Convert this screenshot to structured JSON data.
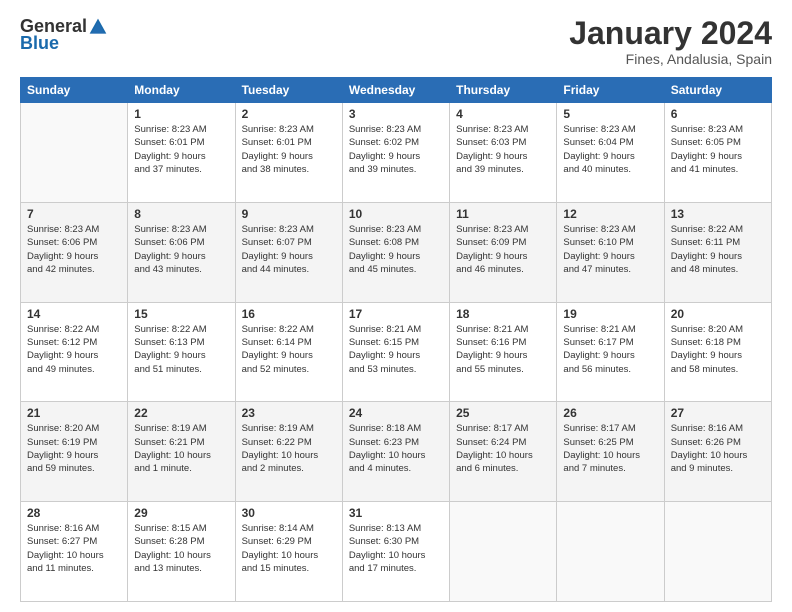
{
  "logo": {
    "general": "General",
    "blue": "Blue"
  },
  "header": {
    "title": "January 2024",
    "subtitle": "Fines, Andalusia, Spain"
  },
  "columns": [
    "Sunday",
    "Monday",
    "Tuesday",
    "Wednesday",
    "Thursday",
    "Friday",
    "Saturday"
  ],
  "weeks": [
    [
      {
        "day": "",
        "info": ""
      },
      {
        "day": "1",
        "info": "Sunrise: 8:23 AM\nSunset: 6:01 PM\nDaylight: 9 hours\nand 37 minutes."
      },
      {
        "day": "2",
        "info": "Sunrise: 8:23 AM\nSunset: 6:01 PM\nDaylight: 9 hours\nand 38 minutes."
      },
      {
        "day": "3",
        "info": "Sunrise: 8:23 AM\nSunset: 6:02 PM\nDaylight: 9 hours\nand 39 minutes."
      },
      {
        "day": "4",
        "info": "Sunrise: 8:23 AM\nSunset: 6:03 PM\nDaylight: 9 hours\nand 39 minutes."
      },
      {
        "day": "5",
        "info": "Sunrise: 8:23 AM\nSunset: 6:04 PM\nDaylight: 9 hours\nand 40 minutes."
      },
      {
        "day": "6",
        "info": "Sunrise: 8:23 AM\nSunset: 6:05 PM\nDaylight: 9 hours\nand 41 minutes."
      }
    ],
    [
      {
        "day": "7",
        "info": "Sunrise: 8:23 AM\nSunset: 6:06 PM\nDaylight: 9 hours\nand 42 minutes."
      },
      {
        "day": "8",
        "info": "Sunrise: 8:23 AM\nSunset: 6:06 PM\nDaylight: 9 hours\nand 43 minutes."
      },
      {
        "day": "9",
        "info": "Sunrise: 8:23 AM\nSunset: 6:07 PM\nDaylight: 9 hours\nand 44 minutes."
      },
      {
        "day": "10",
        "info": "Sunrise: 8:23 AM\nSunset: 6:08 PM\nDaylight: 9 hours\nand 45 minutes."
      },
      {
        "day": "11",
        "info": "Sunrise: 8:23 AM\nSunset: 6:09 PM\nDaylight: 9 hours\nand 46 minutes."
      },
      {
        "day": "12",
        "info": "Sunrise: 8:23 AM\nSunset: 6:10 PM\nDaylight: 9 hours\nand 47 minutes."
      },
      {
        "day": "13",
        "info": "Sunrise: 8:22 AM\nSunset: 6:11 PM\nDaylight: 9 hours\nand 48 minutes."
      }
    ],
    [
      {
        "day": "14",
        "info": "Sunrise: 8:22 AM\nSunset: 6:12 PM\nDaylight: 9 hours\nand 49 minutes."
      },
      {
        "day": "15",
        "info": "Sunrise: 8:22 AM\nSunset: 6:13 PM\nDaylight: 9 hours\nand 51 minutes."
      },
      {
        "day": "16",
        "info": "Sunrise: 8:22 AM\nSunset: 6:14 PM\nDaylight: 9 hours\nand 52 minutes."
      },
      {
        "day": "17",
        "info": "Sunrise: 8:21 AM\nSunset: 6:15 PM\nDaylight: 9 hours\nand 53 minutes."
      },
      {
        "day": "18",
        "info": "Sunrise: 8:21 AM\nSunset: 6:16 PM\nDaylight: 9 hours\nand 55 minutes."
      },
      {
        "day": "19",
        "info": "Sunrise: 8:21 AM\nSunset: 6:17 PM\nDaylight: 9 hours\nand 56 minutes."
      },
      {
        "day": "20",
        "info": "Sunrise: 8:20 AM\nSunset: 6:18 PM\nDaylight: 9 hours\nand 58 minutes."
      }
    ],
    [
      {
        "day": "21",
        "info": "Sunrise: 8:20 AM\nSunset: 6:19 PM\nDaylight: 9 hours\nand 59 minutes."
      },
      {
        "day": "22",
        "info": "Sunrise: 8:19 AM\nSunset: 6:21 PM\nDaylight: 10 hours\nand 1 minute."
      },
      {
        "day": "23",
        "info": "Sunrise: 8:19 AM\nSunset: 6:22 PM\nDaylight: 10 hours\nand 2 minutes."
      },
      {
        "day": "24",
        "info": "Sunrise: 8:18 AM\nSunset: 6:23 PM\nDaylight: 10 hours\nand 4 minutes."
      },
      {
        "day": "25",
        "info": "Sunrise: 8:17 AM\nSunset: 6:24 PM\nDaylight: 10 hours\nand 6 minutes."
      },
      {
        "day": "26",
        "info": "Sunrise: 8:17 AM\nSunset: 6:25 PM\nDaylight: 10 hours\nand 7 minutes."
      },
      {
        "day": "27",
        "info": "Sunrise: 8:16 AM\nSunset: 6:26 PM\nDaylight: 10 hours\nand 9 minutes."
      }
    ],
    [
      {
        "day": "28",
        "info": "Sunrise: 8:16 AM\nSunset: 6:27 PM\nDaylight: 10 hours\nand 11 minutes."
      },
      {
        "day": "29",
        "info": "Sunrise: 8:15 AM\nSunset: 6:28 PM\nDaylight: 10 hours\nand 13 minutes."
      },
      {
        "day": "30",
        "info": "Sunrise: 8:14 AM\nSunset: 6:29 PM\nDaylight: 10 hours\nand 15 minutes."
      },
      {
        "day": "31",
        "info": "Sunrise: 8:13 AM\nSunset: 6:30 PM\nDaylight: 10 hours\nand 17 minutes."
      },
      {
        "day": "",
        "info": ""
      },
      {
        "day": "",
        "info": ""
      },
      {
        "day": "",
        "info": ""
      }
    ]
  ]
}
